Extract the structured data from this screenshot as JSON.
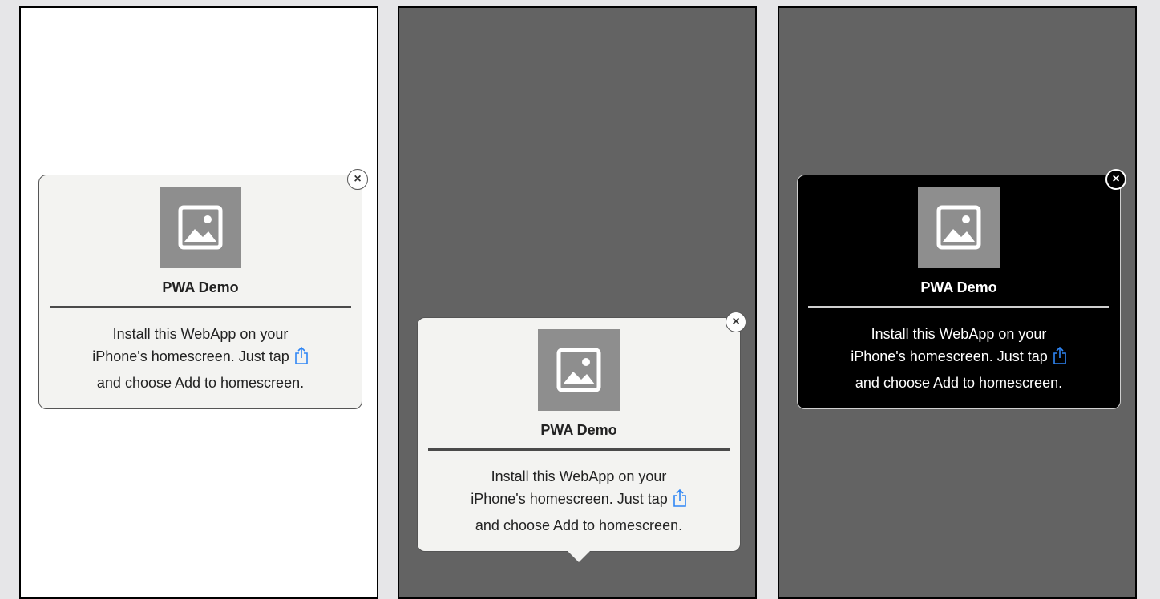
{
  "popups": [
    {
      "app_name": "PWA Demo",
      "line1": "Install this WebApp on your",
      "line2": "iPhone's homescreen. Just tap",
      "line3": "and choose Add to homescreen.",
      "close_label": "×",
      "theme": "light",
      "backdrop": "#ffffff"
    },
    {
      "app_name": "PWA Demo",
      "line1": "Install this WebApp on your",
      "line2": "iPhone's homescreen. Just tap",
      "line3": "and choose Add to homescreen.",
      "close_label": "×",
      "theme": "light",
      "backdrop": "#636363"
    },
    {
      "app_name": "PWA Demo",
      "line1": "Install this WebApp on your",
      "line2": "iPhone's homescreen. Just tap",
      "line3": "and choose Add to homescreen.",
      "close_label": "×",
      "theme": "dark",
      "backdrop": "#636363"
    }
  ],
  "icons": {
    "app_icon": "image-placeholder-icon",
    "share_icon": "share-icon",
    "close_icon": "close-icon"
  },
  "colors": {
    "share_blue": "#2f86f5",
    "icon_gray": "#8e8e8e"
  }
}
